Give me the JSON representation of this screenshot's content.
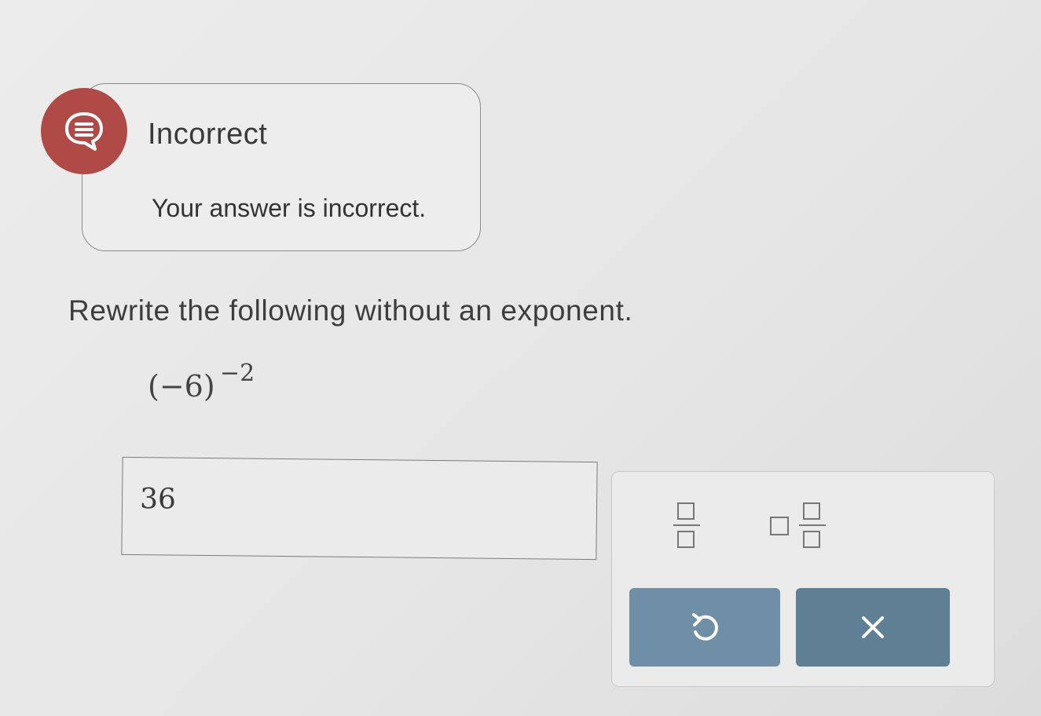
{
  "feedback": {
    "title": "Incorrect",
    "message": "Your answer is incorrect.",
    "icon": "speech-bubble-icon",
    "badge_color": "#b04a47"
  },
  "question": {
    "prompt": "Rewrite the following without an exponent.",
    "expression_base": "(−6)",
    "expression_exponent": "−2"
  },
  "answer": {
    "value": "36"
  },
  "keypad": {
    "fraction_icon": "fraction-icon",
    "mixed_number_icon": "mixed-number-icon",
    "undo_icon": "undo-icon",
    "clear_icon": "close-icon",
    "button_color": "#6f8fa6"
  }
}
